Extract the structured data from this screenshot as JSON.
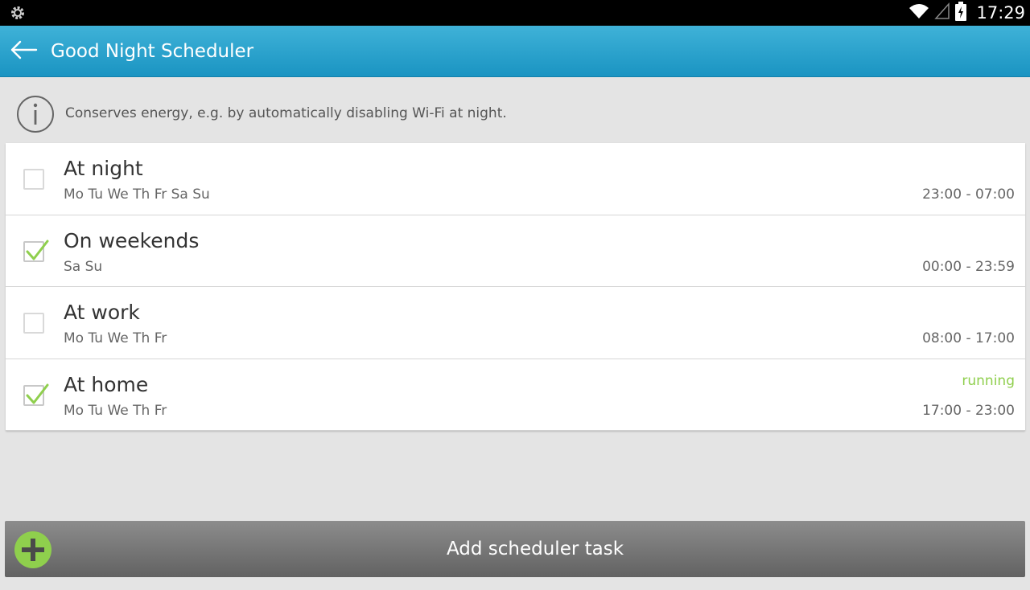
{
  "status_bar": {
    "time": "17:29",
    "left_icon": "settings-gear-icon",
    "icons": [
      "wifi-icon",
      "signal-icon",
      "battery-icon"
    ]
  },
  "app_bar": {
    "title": "Good Night Scheduler",
    "back_icon": "back-arrow-icon",
    "color": "#2aa3cd"
  },
  "info": {
    "icon": "info-icon",
    "text": "Conserves energy, e.g. by automatically disabling Wi-Fi at night."
  },
  "tasks": [
    {
      "name": "At night",
      "days": "Mo Tu We Th Fr Sa Su",
      "time": "23:00 - 07:00",
      "checked": false,
      "state": ""
    },
    {
      "name": "On weekends",
      "days": "Sa Su",
      "time": "00:00 - 23:59",
      "checked": true,
      "state": ""
    },
    {
      "name": "At work",
      "days": "Mo Tu We Th Fr",
      "time": "08:00 - 17:00",
      "checked": false,
      "state": ""
    },
    {
      "name": "At home",
      "days": "Mo Tu We Th Fr",
      "time": "17:00 - 23:00",
      "checked": true,
      "state": "running"
    }
  ],
  "add_task": {
    "label": "Add scheduler task",
    "icon": "plus-icon",
    "accent": "#8fcf4d"
  }
}
